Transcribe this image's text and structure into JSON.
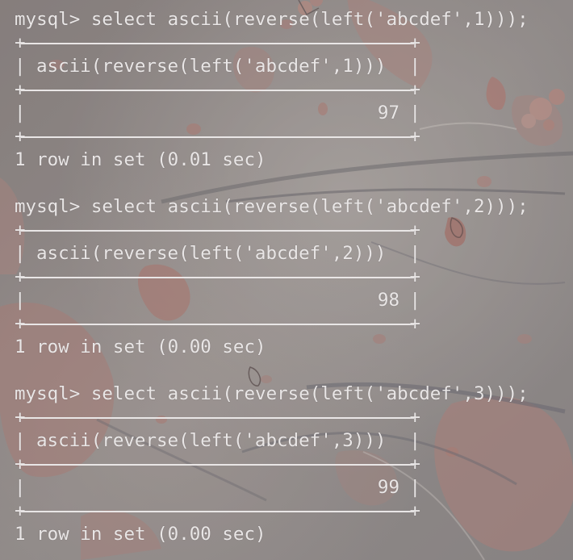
{
  "terminal": {
    "theme": {
      "text_color": "#e9e6e6",
      "background_color": "#8c8785"
    },
    "blocks": [
      {
        "prompt": "mysql>",
        "command": "select ascii(reverse(left('abcdef',1)));",
        "column_header": "ascii(reverse(left('abcdef',1)))",
        "value": "97",
        "footer": "1 row in set (0.01 sec)"
      },
      {
        "prompt": "mysql>",
        "command": "select ascii(reverse(left('abcdef',2)));",
        "column_header": "ascii(reverse(left('abcdef',2)))",
        "value": "98",
        "footer": "1 row in set (0.00 sec)"
      },
      {
        "prompt": "mysql>",
        "command": "select ascii(reverse(left('abcdef',3)));",
        "column_header": "ascii(reverse(left('abcdef',3)))",
        "value": "99",
        "footer": "1 row in set (0.00 sec)"
      }
    ],
    "table_chars": {
      "corner": "+",
      "pipe": "|"
    }
  }
}
